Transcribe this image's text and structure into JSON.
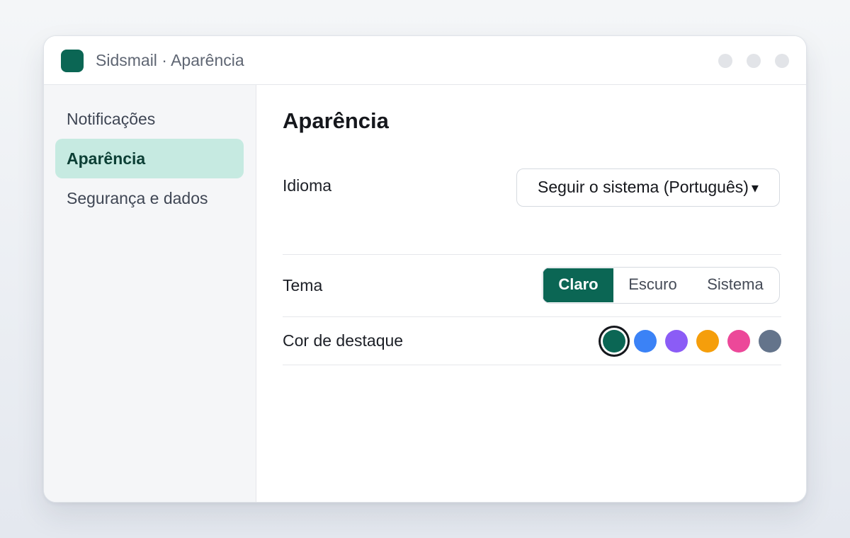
{
  "window": {
    "title": "Sidsmail · Aparência",
    "app_icon": "app-logo-icon",
    "controls": [
      "minimize-dot",
      "maximize-dot",
      "close-dot"
    ]
  },
  "sidebar": {
    "items": [
      {
        "label": "Notificações",
        "active": false
      },
      {
        "label": "Aparência",
        "active": true
      },
      {
        "label": "Segurança e dados",
        "active": false
      }
    ]
  },
  "main": {
    "title": "Aparência",
    "language": {
      "label": "Idioma",
      "value": "Seguir o sistema (Português)",
      "caret": "▾"
    },
    "theme": {
      "label": "Tema",
      "options": [
        "Claro",
        "Escuro",
        "Sistema"
      ],
      "selected": "Claro"
    },
    "accent": {
      "label": "Cor de destaque",
      "colors": [
        "#0b6654",
        "#3b82f6",
        "#8b5cf6",
        "#f59e0b",
        "#ec4899",
        "#64748b"
      ],
      "selected": "#0b6654"
    }
  },
  "colors": {
    "brand": "#0b6654",
    "sidebar_active_bg": "#c6eae1"
  }
}
